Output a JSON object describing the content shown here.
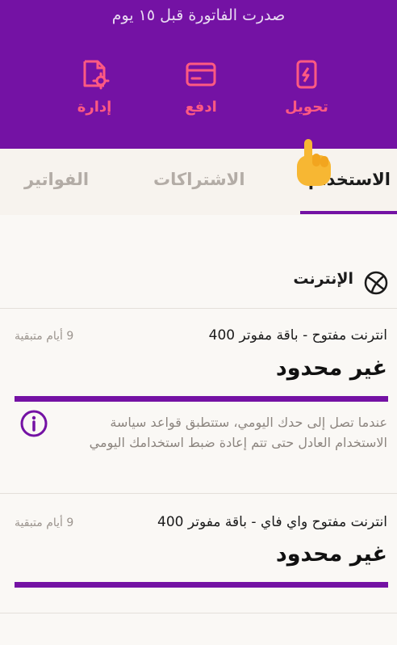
{
  "header": {
    "invoice_note": "صدرت الفاتورة قبل ١٥ يوم",
    "actions": [
      {
        "label": "تحويل",
        "icon": "phone-transfer-icon"
      },
      {
        "label": "ادفع",
        "icon": "credit-card-icon"
      },
      {
        "label": "إدارة",
        "icon": "document-gear-icon"
      }
    ]
  },
  "tabs": {
    "usage": "الاستخدام",
    "subscriptions": "الاشتراكات",
    "bills": "الفواتير"
  },
  "section": {
    "title": "الإنترنت",
    "icon": "globe-icon"
  },
  "plans": [
    {
      "name": "انترنت مفتوح - باقة  مفوتر 400",
      "days": "9 أيام متبقية",
      "value": "غير محدود"
    },
    {
      "name": "انترنت مفتوح واي فاي - باقة  مفوتر 400",
      "days": "9 أيام متبقية",
      "value": "غير محدود"
    }
  ],
  "info": {
    "text": "عندما تصل إلى حدك اليومي، ستتطبق قواعد سياسة الاستخدام العادل حتى تتم إعادة ضبط استخدامك اليومي"
  },
  "colors": {
    "brand_purple": "#7412a4",
    "accent_pink": "#ff5a82",
    "background": "#f7f3ee"
  }
}
